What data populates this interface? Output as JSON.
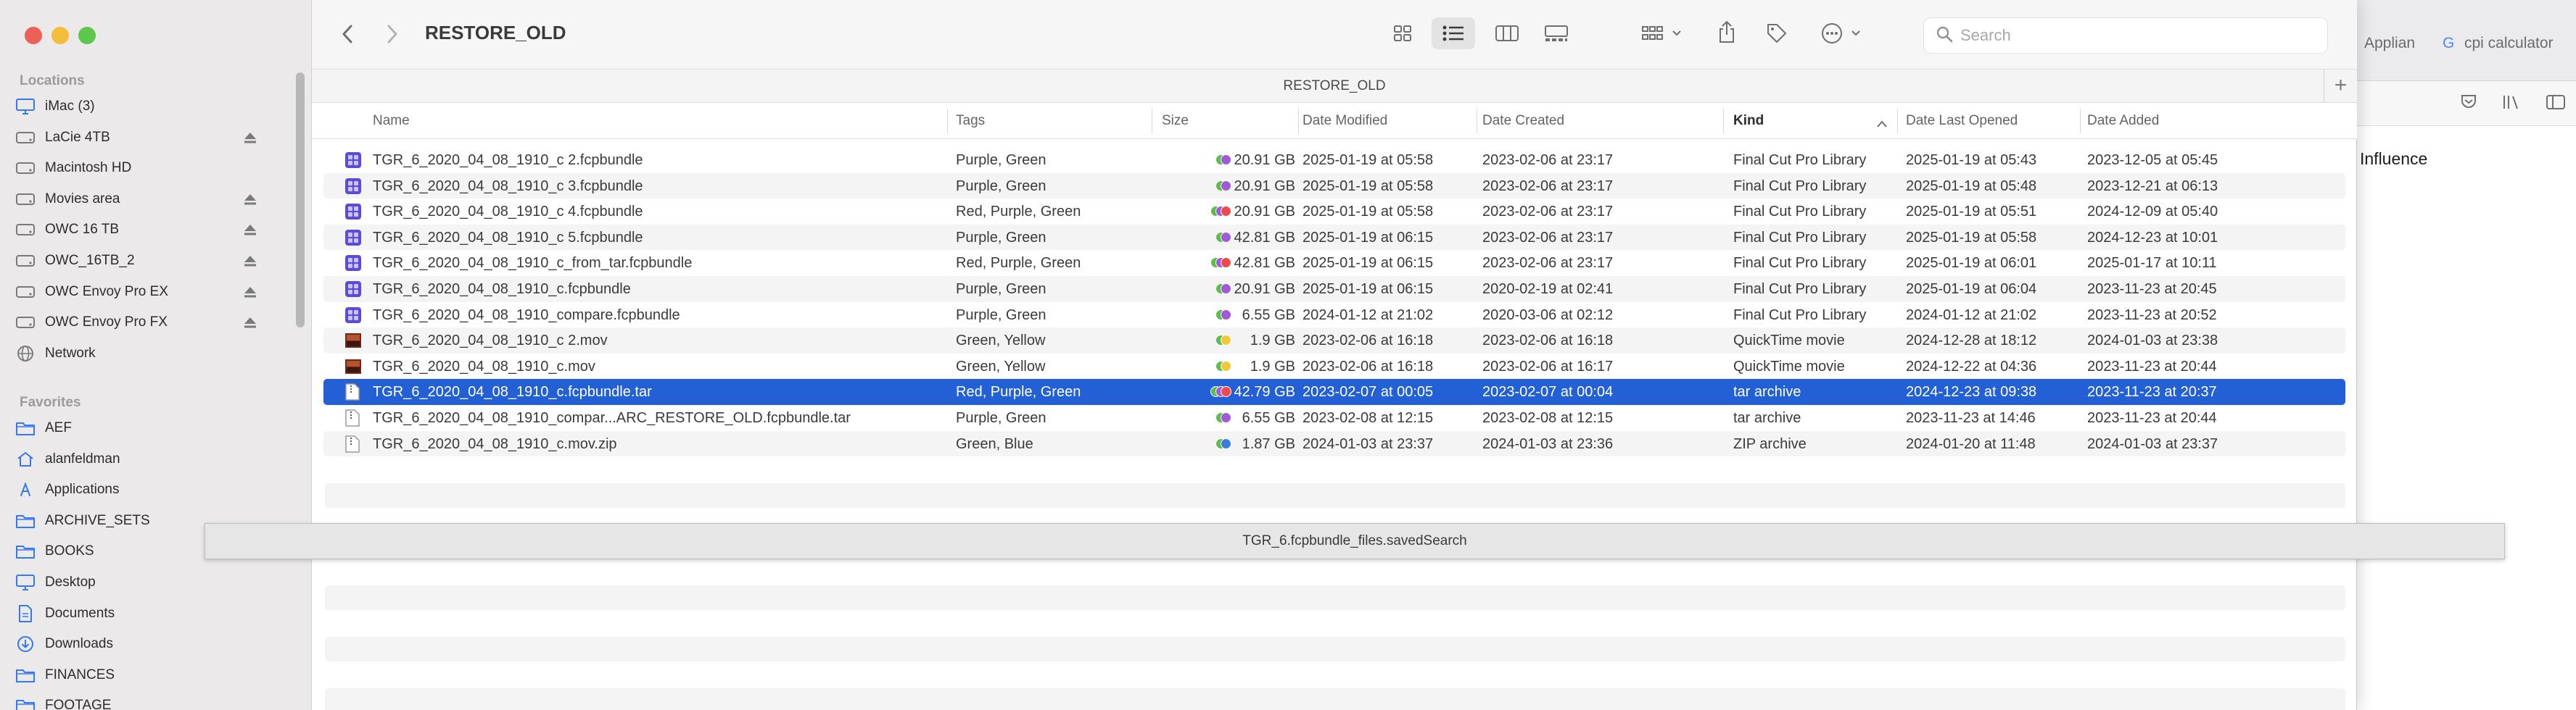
{
  "browser": {
    "tabs": [
      "Applian",
      "cpi calculator"
    ],
    "content_text": "Influence"
  },
  "finder": {
    "folder_title": "RESTORE_OLD",
    "path_title": "RESTORE_OLD",
    "search_placeholder": "Search",
    "sidebar": {
      "locations_heading": "Locations",
      "locations": [
        {
          "label": "iMac (3)",
          "icon": "imac-icon",
          "eject": false
        },
        {
          "label": "LaCie 4TB",
          "icon": "drive-icon",
          "eject": true
        },
        {
          "label": "Macintosh HD",
          "icon": "drive-icon",
          "eject": false
        },
        {
          "label": "Movies area",
          "icon": "drive-icon",
          "eject": true
        },
        {
          "label": "OWC 16 TB",
          "icon": "drive-icon",
          "eject": true
        },
        {
          "label": "OWC_16TB_2",
          "icon": "drive-icon",
          "eject": true
        },
        {
          "label": "OWC Envoy Pro EX",
          "icon": "drive-icon",
          "eject": true
        },
        {
          "label": "OWC Envoy Pro FX",
          "icon": "drive-icon",
          "eject": true
        },
        {
          "label": "Network",
          "icon": "network-icon",
          "eject": false
        }
      ],
      "favorites_heading": "Favorites",
      "favorites": [
        {
          "label": "AEF",
          "icon": "folder-icon"
        },
        {
          "label": "alanfeldman",
          "icon": "home-icon"
        },
        {
          "label": "Applications",
          "icon": "applications-icon"
        },
        {
          "label": "ARCHIVE_SETS",
          "icon": "folder-icon"
        },
        {
          "label": "BOOKS",
          "icon": "folder-icon"
        },
        {
          "label": "Desktop",
          "icon": "desktop-icon"
        },
        {
          "label": "Documents",
          "icon": "document-icon"
        },
        {
          "label": "Downloads",
          "icon": "downloads-icon"
        },
        {
          "label": "FINANCES",
          "icon": "folder-icon"
        },
        {
          "label": "FOOTAGE",
          "icon": "folder-icon"
        }
      ]
    },
    "columns": {
      "name": "Name",
      "tags": "Tags",
      "size": "Size",
      "date_modified": "Date Modified",
      "date_created": "Date Created",
      "kind": "Kind",
      "date_last_opened": "Date Last Opened",
      "date_added": "Date Added"
    },
    "rows": [
      {
        "name": "TGR_6_2020_04_08_1910_c 2.fcpbundle",
        "icon": "fcp-library-icon",
        "tag_colors": [
          "#5bbd4a",
          "#a259d9"
        ],
        "tags": "Purple, Green",
        "size": "20.91 GB",
        "modified": "2025-01-19 at 05:58",
        "created": "2023-02-06 at 23:17",
        "kind": "Final Cut Pro Library",
        "last_opened": "2025-01-19 at 05:43",
        "added": "2023-12-05 at 05:45"
      },
      {
        "name": "TGR_6_2020_04_08_1910_c 3.fcpbundle",
        "icon": "fcp-library-icon",
        "tag_colors": [
          "#5bbd4a",
          "#a259d9"
        ],
        "tags": "Purple, Green",
        "size": "20.91 GB",
        "modified": "2025-01-19 at 05:58",
        "created": "2023-02-06 at 23:17",
        "kind": "Final Cut Pro Library",
        "last_opened": "2025-01-19 at 05:48",
        "added": "2023-12-21 at 06:13"
      },
      {
        "name": "TGR_6_2020_04_08_1910_c 4.fcpbundle",
        "icon": "fcp-library-icon",
        "tag_colors": [
          "#5bbd4a",
          "#a259d9",
          "#ef4a4a"
        ],
        "tags": "Red, Purple, Green",
        "size": "20.91 GB",
        "modified": "2025-01-19 at 05:58",
        "created": "2023-02-06 at 23:17",
        "kind": "Final Cut Pro Library",
        "last_opened": "2025-01-19 at 05:51",
        "added": "2024-12-09 at 05:40"
      },
      {
        "name": "TGR_6_2020_04_08_1910_c 5.fcpbundle",
        "icon": "fcp-library-icon",
        "tag_colors": [
          "#5bbd4a",
          "#a259d9"
        ],
        "tags": "Purple, Green",
        "size": "42.81 GB",
        "modified": "2025-01-19 at 06:15",
        "created": "2023-02-06 at 23:17",
        "kind": "Final Cut Pro Library",
        "last_opened": "2025-01-19 at 05:58",
        "added": "2024-12-23 at 10:01"
      },
      {
        "name": "TGR_6_2020_04_08_1910_c_from_tar.fcpbundle",
        "icon": "fcp-library-icon",
        "tag_colors": [
          "#5bbd4a",
          "#a259d9",
          "#ef4a4a"
        ],
        "tags": "Red, Purple, Green",
        "size": "42.81 GB",
        "modified": "2025-01-19 at 06:15",
        "created": "2023-02-06 at 23:17",
        "kind": "Final Cut Pro Library",
        "last_opened": "2025-01-19 at 06:01",
        "added": "2025-01-17 at 10:11"
      },
      {
        "name": "TGR_6_2020_04_08_1910_c.fcpbundle",
        "icon": "fcp-library-icon",
        "tag_colors": [
          "#5bbd4a",
          "#a259d9"
        ],
        "tags": "Purple, Green",
        "size": "20.91 GB",
        "modified": "2025-01-19 at 06:15",
        "created": "2020-02-19 at 02:41",
        "kind": "Final Cut Pro Library",
        "last_opened": "2025-01-19 at 06:04",
        "added": "2023-11-23 at 20:45"
      },
      {
        "name": "TGR_6_2020_04_08_1910_compare.fcpbundle",
        "icon": "fcp-library-icon",
        "tag_colors": [
          "#5bbd4a",
          "#a259d9"
        ],
        "tags": "Purple, Green",
        "size": "6.55 GB",
        "modified": "2024-01-12 at 21:02",
        "created": "2020-03-06 at 02:12",
        "kind": "Final Cut Pro Library",
        "last_opened": "2024-01-12 at 21:02",
        "added": "2023-11-23 at 20:52"
      },
      {
        "name": "TGR_6_2020_04_08_1910_c 2.mov",
        "icon": "movie-thumbnail-icon",
        "tag_colors": [
          "#5bbd4a",
          "#f2c83a"
        ],
        "tags": "Green, Yellow",
        "size": "1.9 GB",
        "modified": "2023-02-06 at 16:18",
        "created": "2023-02-06 at 16:18",
        "kind": "QuickTime movie",
        "last_opened": "2024-12-28 at 18:12",
        "added": "2024-01-03 at 23:38"
      },
      {
        "name": "TGR_6_2020_04_08_1910_c.mov",
        "icon": "movie-thumbnail-icon",
        "tag_colors": [
          "#5bbd4a",
          "#f2c83a"
        ],
        "tags": "Green, Yellow",
        "size": "1.9 GB",
        "modified": "2023-02-06 at 16:18",
        "created": "2023-02-06 at 16:17",
        "kind": "QuickTime movie",
        "last_opened": "2024-12-22 at 04:36",
        "added": "2023-11-23 at 20:44"
      },
      {
        "name": "TGR_6_2020_04_08_1910_c.fcpbundle.tar",
        "icon": "archive-document-icon",
        "tag_colors": [
          "#5bbd4a",
          "#a259d9",
          "#ef4a4a"
        ],
        "tags": "Red, Purple, Green",
        "size": "42.79 GB",
        "modified": "2023-02-07 at 00:05",
        "created": "2023-02-07 at 00:04",
        "kind": "tar archive",
        "last_opened": "2024-12-23 at 09:38",
        "added": "2023-11-23 at 20:37",
        "selected": true
      },
      {
        "name": "TGR_6_2020_04_08_1910_compar...ARC_RESTORE_OLD.fcpbundle.tar",
        "icon": "archive-document-icon",
        "tag_colors": [
          "#5bbd4a",
          "#a259d9"
        ],
        "tags": "Purple, Green",
        "size": "6.55 GB",
        "modified": "2023-02-08 at 12:15",
        "created": "2023-02-08 at 12:15",
        "kind": "tar archive",
        "last_opened": "2023-11-23 at 14:46",
        "added": "2023-11-23 at 20:44"
      },
      {
        "name": "TGR_6_2020_04_08_1910_c.mov.zip",
        "icon": "archive-document-icon",
        "tag_colors": [
          "#5bbd4a",
          "#3a7be8"
        ],
        "tags": "Green, Blue",
        "size": "1.87 GB",
        "modified": "2024-01-03 at 23:37",
        "created": "2024-01-03 at 23:36",
        "kind": "ZIP archive",
        "last_opened": "2024-01-20 at 11:48",
        "added": "2024-01-03 at 23:37"
      }
    ],
    "saved_search_bar": "TGR_6.fcpbundle_files.savedSearch"
  }
}
